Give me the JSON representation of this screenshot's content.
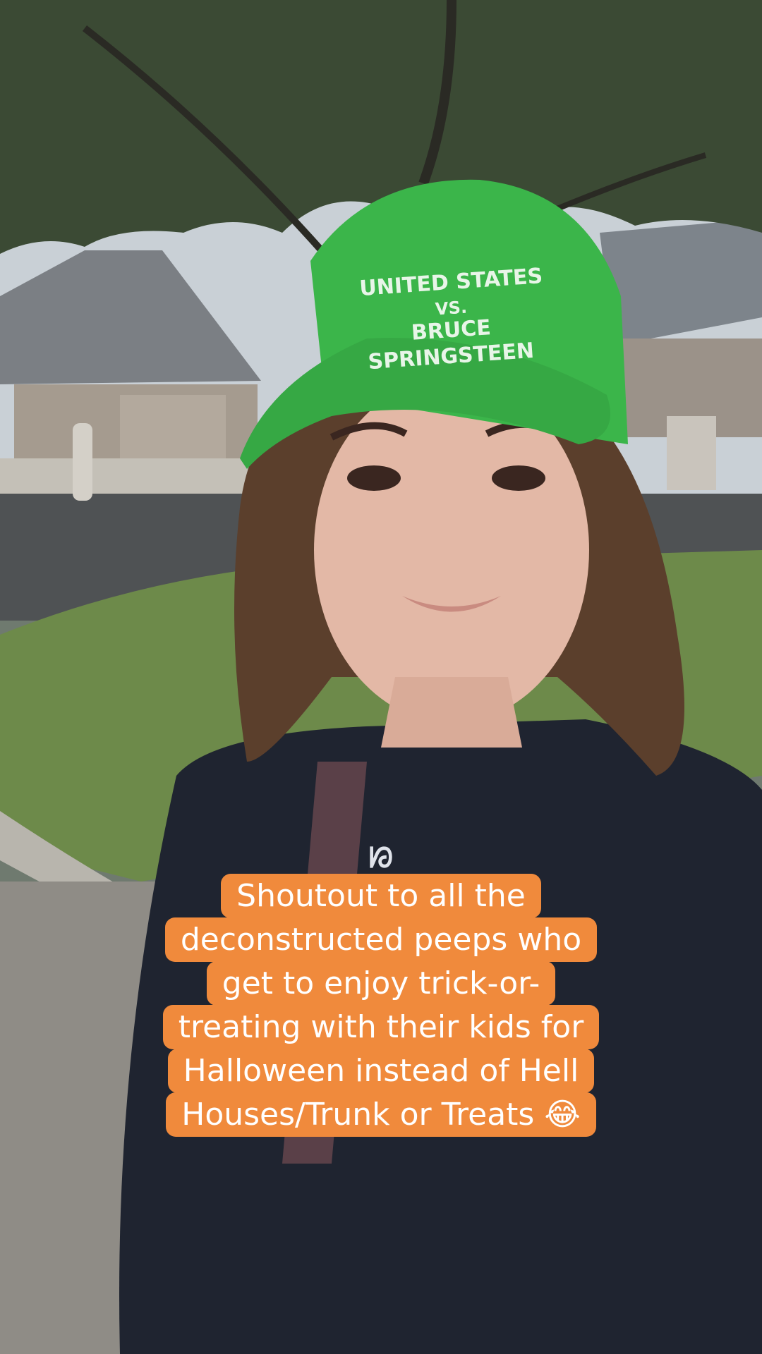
{
  "photo": {
    "hat_text": "UNITED STATES VS. BRUCE SPRINGSTEEN"
  },
  "caption": {
    "lines": [
      "Shoutout to all the",
      "deconstructed peeps who",
      "get to enjoy trick-or-",
      "treating with their kids for",
      "Halloween instead of Hell",
      "Houses/Trunk or Treats 😂"
    ],
    "background_color": "#f08a3c",
    "text_color": "#ffffff"
  }
}
